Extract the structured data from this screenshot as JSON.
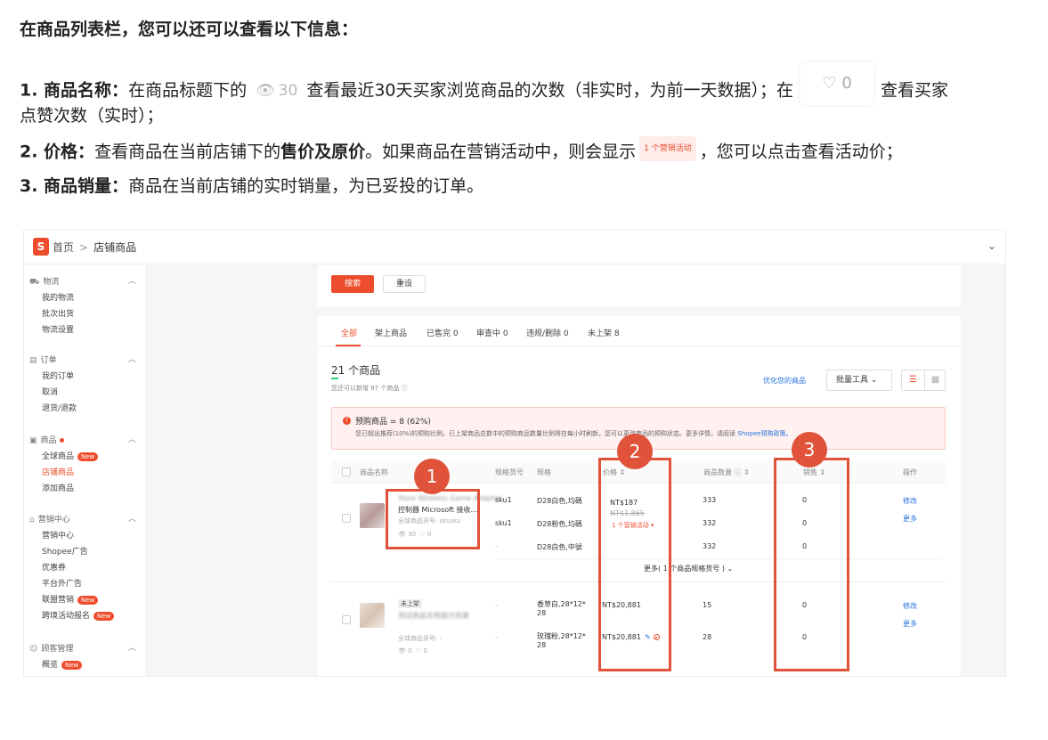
{
  "help": {
    "heading": "在商品列表栏，您可以还可以查看以下信息：",
    "line1": {
      "label": "1. 商品名称：",
      "text_a": "在商品标题下的",
      "eye_value": "30",
      "text_b": "查看最近30天买家浏览商品的次数（非实时，为前一天数据）；在",
      "heart_value": "0",
      "text_c": "查看买家",
      "text_d": "点赞次数（实时）；"
    },
    "line2": {
      "label": "2. 价格：",
      "text_a": "查看商品在当前店铺下的",
      "bold": "售价及原价",
      "text_b": "。如果商品在营销活动中，则会显示",
      "promo_chip": "1 个营销活动",
      "text_c": "，您可以点击查看活动价；"
    },
    "line3": {
      "label": "3. 商品销量：",
      "text": "商品在当前店铺的实时销量，为已妥投的订单。"
    }
  },
  "panel": {
    "logo": "S",
    "breadcrumb": {
      "home": "首页",
      "sep": ">",
      "current": "店铺商品"
    },
    "top_chevron": "⌄",
    "sidebar": [
      {
        "icon": "truck-icon",
        "title": "物流",
        "items": [
          "我的物流",
          "批次出货",
          "物流设置"
        ]
      },
      {
        "icon": "clipboard-icon",
        "title": "订单",
        "items": [
          "我的订单",
          "取消",
          "退货/退款"
        ]
      },
      {
        "icon": "bag-icon",
        "title": "商品",
        "items": [
          "全球商品",
          "店铺商品",
          "添加商品"
        ],
        "new_on": 0,
        "active": 1,
        "dot": true
      },
      {
        "icon": "tag-icon",
        "title": "营销中心",
        "items": [
          "营销中心",
          "Shopee广告",
          "优惠券",
          "平台外广告",
          "联盟营销",
          "跨境活动报名"
        ],
        "new_on": [
          4,
          5
        ]
      },
      {
        "icon": "user-icon",
        "title": "顾客管理",
        "items": [
          "概览"
        ],
        "new_on": 0
      }
    ],
    "new_label": "New",
    "search_button": "搜索",
    "reset_button": "重设",
    "tabs": [
      "全部",
      "架上商品",
      "已售完 0",
      "审查中 0",
      "违规/删除 0",
      "未上架 8"
    ],
    "count": "21 个商品",
    "count_hint": "您还可以新增 87 个商品 ⓘ",
    "optimize_link": "优化您的商品",
    "bulk_tools": "批量工具",
    "alert": {
      "title": "预购商品 = 8 (62%)",
      "body": "您已超出推荐(10%)的预购比例。已上架商品总数中的预购商品数量比例将在每小时刷新。您可以更改商品的预购状态。更多详情，请阅读 ",
      "link": "Shopee预购政策。"
    },
    "columns": [
      "商品名称",
      "规格货号",
      "规格",
      "价格 ⇕",
      "商品数量 ⓘ ⇕",
      "销售 ⇕",
      "操作"
    ],
    "products": [
      {
        "blurred_title": "Xbox Wireless Game Adapter",
        "name": "控制器 Microsoft 接收...",
        "global_sku": "全球商品货号: skusku",
        "views": "30",
        "likes": "0",
        "variants": [
          {
            "sku": "sku1",
            "spec": "D28白色,均碼",
            "price": "NT$187",
            "orig_price": "NT$1,865",
            "promo": "1 个营销活动 ▾",
            "qty": "333",
            "sales": "0"
          },
          {
            "sku": "sku1",
            "spec": "D28粉色,均碼",
            "qty": "332",
            "sales": "0"
          },
          {
            "sku": "-",
            "spec": "D28白色,中號",
            "qty": "332",
            "sales": "0"
          }
        ],
        "actions": [
          "修改",
          "更多"
        ],
        "more_specs": "更多( 1 个商品规格货号 ) ⌄"
      },
      {
        "status_tag": "未上架",
        "blurred_title": "测试商品名称展示效果",
        "global_sku": "全球商品货号: -",
        "views": "0",
        "likes": "0",
        "variants": [
          {
            "sku": "-",
            "spec": "香草白,28*12*",
            "spec2": "28",
            "price": "NT$20,881",
            "qty": "15",
            "sales": "0"
          },
          {
            "sku": "-",
            "spec": "玫瑰粉,28*12*",
            "spec2": "28",
            "price": "NT$20,881",
            "qty": "28",
            "sales": "0"
          }
        ],
        "actions": [
          "修改",
          "更多"
        ]
      }
    ]
  },
  "callouts": [
    "1",
    "2",
    "3"
  ],
  "colors": {
    "accent": "#ee4d2d",
    "callout": "#e0533a",
    "link": "#2673dd"
  }
}
